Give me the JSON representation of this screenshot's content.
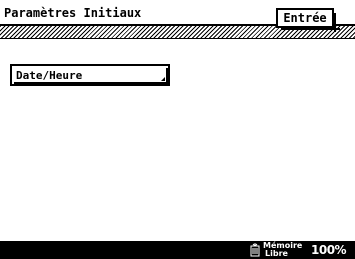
{
  "header": {
    "title": "Paramètres Initiaux",
    "enter_label": "Entrée"
  },
  "main": {
    "buttons": [
      {
        "label": "Date/Heure"
      }
    ]
  },
  "footer": {
    "memory_label_line1": "Mémoire",
    "memory_label_line2": "Libre",
    "memory_value": "100%",
    "icon": "memory-icon"
  },
  "colors": {
    "foreground": "#000000",
    "background": "#ffffff",
    "footer_background": "#000000",
    "footer_text": "#ffffff"
  }
}
